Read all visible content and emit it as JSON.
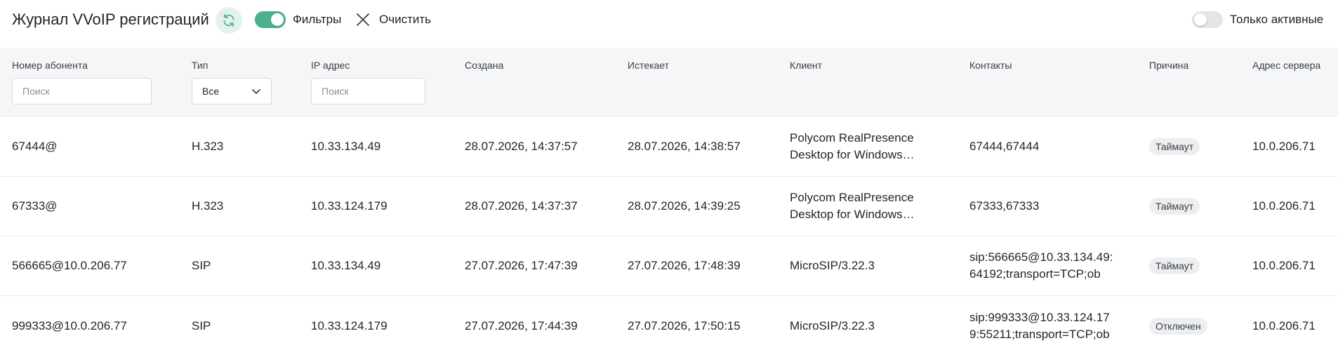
{
  "header": {
    "title": "Журнал VVoIP регистраций",
    "filters_label": "Фильтры",
    "clear_label": "Очистить",
    "only_active_label": "Только активные",
    "filters_toggle_on": true,
    "only_active_toggle_on": false,
    "accent_color": "#4caf8d"
  },
  "columns": {
    "number": "Номер абонента",
    "type": "Тип",
    "ip": "IP адрес",
    "created": "Создана",
    "expires": "Истекает",
    "client": "Клиент",
    "contacts": "Контакты",
    "reason": "Причина",
    "server": "Адрес сервера"
  },
  "filters": {
    "number_placeholder": "Поиск",
    "type_value": "Все",
    "ip_placeholder": "Поиск"
  },
  "rows": [
    {
      "number": "67444@",
      "type": "H.323",
      "ip": "10.33.134.49",
      "created": "28.07.2026, 14:37:57",
      "expires": "28.07.2026, 14:38:57",
      "client_line1": "Polycom RealPresence",
      "client_line2": "Desktop for Windows…",
      "contacts_line1": "67444,67444",
      "contacts_line2": "",
      "reason": "Таймаут",
      "server": "10.0.206.71"
    },
    {
      "number": "67333@",
      "type": "H.323",
      "ip": "10.33.124.179",
      "created": "28.07.2026, 14:37:37",
      "expires": "28.07.2026, 14:39:25",
      "client_line1": "Polycom RealPresence",
      "client_line2": "Desktop for Windows…",
      "contacts_line1": "67333,67333",
      "contacts_line2": "",
      "reason": "Таймаут",
      "server": "10.0.206.71"
    },
    {
      "number": "566665@10.0.206.77",
      "type": "SIP",
      "ip": "10.33.134.49",
      "created": "27.07.2026, 17:47:39",
      "expires": "27.07.2026, 17:48:39",
      "client_line1": "MicroSIP/3.22.3",
      "client_line2": "",
      "contacts_line1": "sip:566665@10.33.134.49:",
      "contacts_line2": "64192;transport=TCP;ob",
      "reason": "Таймаут",
      "server": "10.0.206.71"
    },
    {
      "number": "999333@10.0.206.77",
      "type": "SIP",
      "ip": "10.33.124.179",
      "created": "27.07.2026, 17:44:39",
      "expires": "27.07.2026, 17:50:15",
      "client_line1": "MicroSIP/3.22.3",
      "client_line2": "",
      "contacts_line1": "sip:999333@10.33.124.17",
      "contacts_line2": "9:55211;transport=TCP;ob",
      "reason": "Отключен",
      "server": "10.0.206.71"
    }
  ]
}
